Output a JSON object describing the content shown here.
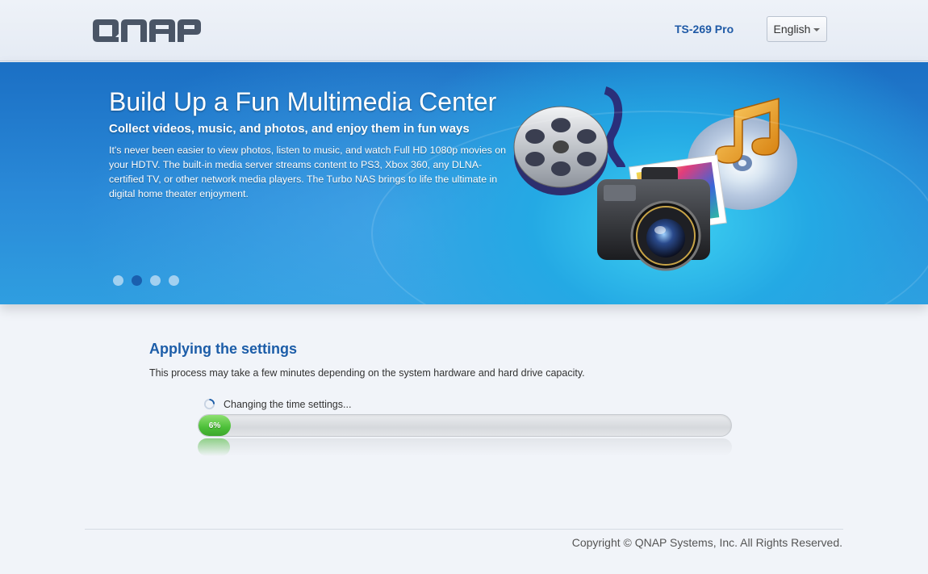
{
  "header": {
    "logo_text": "QNAP",
    "model": "TS-269 Pro",
    "language": "English"
  },
  "banner": {
    "title": "Build Up a Fun Multimedia Center",
    "subtitle": "Collect videos, music, and photos, and enjoy them in fun ways",
    "body": "It's never been easier to view photos, listen to music, and watch Full HD 1080p movies on your HDTV. The built-in media server streams content to PS3, Xbox 360, any DLNA-certified TV, or other network media players. The Turbo NAS brings to life the ultimate in digital home theater enjoyment.",
    "slides": 4,
    "active_slide": 2,
    "icons": [
      "film-reel-icon",
      "camera-icon",
      "music-cd-icon",
      "photos-icon"
    ]
  },
  "main": {
    "title": "Applying the settings",
    "description": "This process may take a few minutes depending on the system hardware and hard drive capacity.",
    "status": "Changing the time settings...",
    "progress_percent": 6,
    "progress_label": "6%"
  },
  "footer": {
    "copyright": "Copyright © QNAP Systems, Inc. All Rights Reserved."
  },
  "colors": {
    "accent": "#1c5da8",
    "progress": "#4cbf38",
    "banner": "#2a8ad8"
  }
}
